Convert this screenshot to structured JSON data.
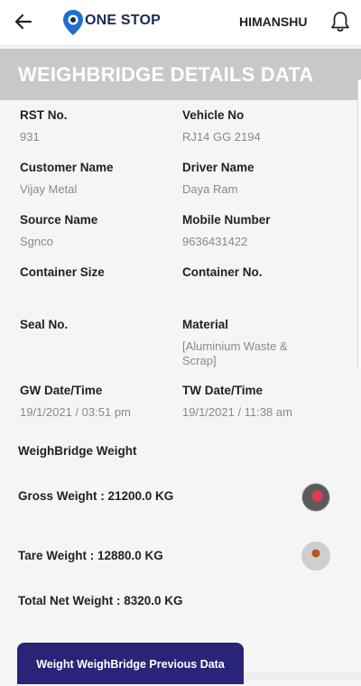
{
  "header": {
    "brand": "ONE STOP",
    "user_name": "HIMANSHU"
  },
  "section": {
    "title": "WEIGHBRIDGE DETAILS DATA"
  },
  "details": {
    "rst_label": "RST No.",
    "rst_value": "931",
    "vehicle_label": "Vehicle No",
    "vehicle_value": "RJ14 GG 2194",
    "customer_label": "Customer Name",
    "customer_value": "Vijay Metal",
    "driver_label": "Driver Name",
    "driver_value": "Daya Ram",
    "source_label": "Source Name",
    "source_value": "Sgnco",
    "mobile_label": "Mobile Number",
    "mobile_value": "9636431422",
    "container_size_label": "Container Size",
    "container_no_label": "Container No.",
    "seal_label": "Seal No.",
    "material_label": "Material",
    "material_value": "[Aluminium Waste & Scrap]",
    "gw_label": "GW Date/Time",
    "gw_value": "19/1/2021 / 03:51 pm",
    "tw_label": "TW Date/Time",
    "tw_value": "19/1/2021 / 11:38 am"
  },
  "weights": {
    "heading": "WeighBridge Weight",
    "gross": "Gross Weight : 21200.0 KG",
    "tare": "Tare Weight : 12880.0 KG",
    "net": "Total Net Weight : 8320.0 KG"
  },
  "actions": {
    "previous_data_label": "Weight WeighBridge Previous Data"
  },
  "colors": {
    "brand_navy": "#1c2757",
    "button_indigo": "#2a2478",
    "title_bar_gray": "#c8c8c8",
    "value_gray": "#8a8a8a"
  },
  "icons": {
    "back": "arrow-left-icon",
    "logo": "location-pin-logo-icon",
    "bell": "bell-icon",
    "gross_photo": "gross-weight-photo-thumbnail",
    "tare_photo": "tare-weight-photo-thumbnail"
  }
}
